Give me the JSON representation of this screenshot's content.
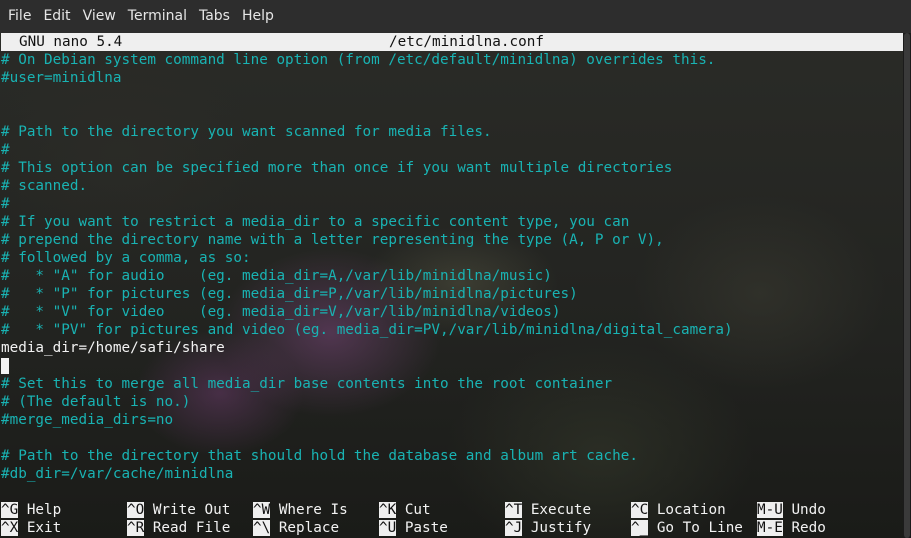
{
  "menu": [
    "File",
    "Edit",
    "View",
    "Terminal",
    "Tabs",
    "Help"
  ],
  "nano": {
    "version": "GNU nano 5.4",
    "filename": "/etc/minidlna.conf"
  },
  "lines": [
    {
      "text": "# On Debian system command line option (from /etc/default/minidlna) overrides this.",
      "type": "comment"
    },
    {
      "text": "#user=minidlna",
      "type": "comment"
    },
    {
      "text": "",
      "type": "comment"
    },
    {
      "text": "",
      "type": "comment"
    },
    {
      "text": "# Path to the directory you want scanned for media files.",
      "type": "comment"
    },
    {
      "text": "#",
      "type": "comment"
    },
    {
      "text": "# This option can be specified more than once if you want multiple directories",
      "type": "comment"
    },
    {
      "text": "# scanned.",
      "type": "comment"
    },
    {
      "text": "#",
      "type": "comment"
    },
    {
      "text": "# If you want to restrict a media_dir to a specific content type, you can",
      "type": "comment"
    },
    {
      "text": "# prepend the directory name with a letter representing the type (A, P or V),",
      "type": "comment"
    },
    {
      "text": "# followed by a comma, as so:",
      "type": "comment"
    },
    {
      "text": "#   * \"A\" for audio    (eg. media_dir=A,/var/lib/minidlna/music)",
      "type": "comment"
    },
    {
      "text": "#   * \"P\" for pictures (eg. media_dir=P,/var/lib/minidlna/pictures)",
      "type": "comment"
    },
    {
      "text": "#   * \"V\" for video    (eg. media_dir=V,/var/lib/minidlna/videos)",
      "type": "comment"
    },
    {
      "text": "#   * \"PV\" for pictures and video (eg. media_dir=PV,/var/lib/minidlna/digital_camera)",
      "type": "comment"
    },
    {
      "text": "media_dir=/home/safi/share",
      "type": "plain"
    },
    {
      "text": "",
      "type": "plain"
    },
    {
      "text": "# Set this to merge all media_dir base contents into the root container",
      "type": "comment"
    },
    {
      "text": "# (The default is no.)",
      "type": "comment"
    },
    {
      "text": "#merge_media_dirs=no",
      "type": "comment"
    },
    {
      "text": "",
      "type": "comment"
    },
    {
      "text": "# Path to the directory that should hold the database and album art cache.",
      "type": "comment"
    },
    {
      "text": "#db_dir=/var/cache/minidlna",
      "type": "comment"
    }
  ],
  "shortcuts": [
    [
      {
        "key": "^G",
        "label": "Help"
      },
      {
        "key": "^O",
        "label": "Write Out"
      },
      {
        "key": "^W",
        "label": "Where Is"
      },
      {
        "key": "^K",
        "label": "Cut"
      },
      {
        "key": "^T",
        "label": "Execute"
      },
      {
        "key": "^C",
        "label": "Location"
      },
      {
        "key": "M-U",
        "label": "Undo"
      }
    ],
    [
      {
        "key": "^X",
        "label": "Exit"
      },
      {
        "key": "^R",
        "label": "Read File"
      },
      {
        "key": "^\\",
        "label": "Replace"
      },
      {
        "key": "^U",
        "label": "Paste"
      },
      {
        "key": "^J",
        "label": "Justify"
      },
      {
        "key": "^_",
        "label": "Go To Line"
      },
      {
        "key": "M-E",
        "label": "Redo"
      }
    ]
  ]
}
